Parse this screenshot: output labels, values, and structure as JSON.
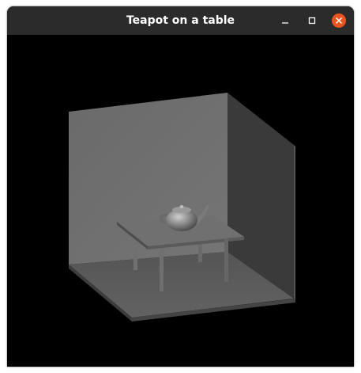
{
  "window": {
    "title": "Teapot on a table"
  },
  "controls": {
    "minimize_icon": "minimize-icon",
    "maximize_icon": "maximize-icon",
    "close_icon": "close-icon",
    "close_color": "#e95420"
  },
  "colors": {
    "titlebar": "#2b2b2b",
    "viewport_background": "#000000",
    "left_wall": "#6e6e6e",
    "right_wall": "#3a3a3a",
    "floor": "#5c5c5c",
    "table_top": "#707070",
    "teapot": "#8a8a8a"
  }
}
